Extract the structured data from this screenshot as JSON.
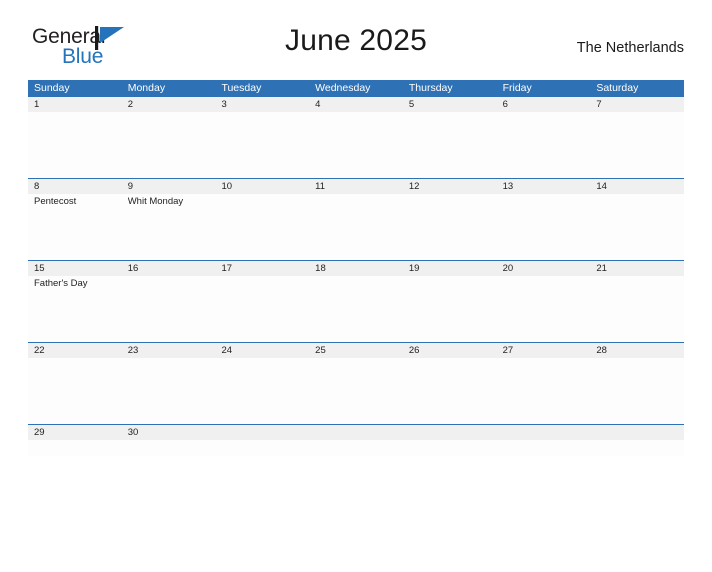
{
  "header": {
    "logo": {
      "text_primary": "General",
      "text_secondary": "Blue",
      "mark": "triangle-flag-icon"
    },
    "title": "June 2025",
    "region": "The Netherlands"
  },
  "calendar": {
    "weekdays": [
      "Sunday",
      "Monday",
      "Tuesday",
      "Wednesday",
      "Thursday",
      "Friday",
      "Saturday"
    ],
    "accent_color": "#2e71b4",
    "band_color": "#f0f0f0",
    "weeks": [
      {
        "days": [
          {
            "num": "1",
            "event": ""
          },
          {
            "num": "2",
            "event": ""
          },
          {
            "num": "3",
            "event": ""
          },
          {
            "num": "4",
            "event": ""
          },
          {
            "num": "5",
            "event": ""
          },
          {
            "num": "6",
            "event": ""
          },
          {
            "num": "7",
            "event": ""
          }
        ]
      },
      {
        "days": [
          {
            "num": "8",
            "event": "Pentecost"
          },
          {
            "num": "9",
            "event": "Whit Monday"
          },
          {
            "num": "10",
            "event": ""
          },
          {
            "num": "11",
            "event": ""
          },
          {
            "num": "12",
            "event": ""
          },
          {
            "num": "13",
            "event": ""
          },
          {
            "num": "14",
            "event": ""
          }
        ]
      },
      {
        "days": [
          {
            "num": "15",
            "event": "Father's Day"
          },
          {
            "num": "16",
            "event": ""
          },
          {
            "num": "17",
            "event": ""
          },
          {
            "num": "18",
            "event": ""
          },
          {
            "num": "19",
            "event": ""
          },
          {
            "num": "20",
            "event": ""
          },
          {
            "num": "21",
            "event": ""
          }
        ]
      },
      {
        "days": [
          {
            "num": "22",
            "event": ""
          },
          {
            "num": "23",
            "event": ""
          },
          {
            "num": "24",
            "event": ""
          },
          {
            "num": "25",
            "event": ""
          },
          {
            "num": "26",
            "event": ""
          },
          {
            "num": "27",
            "event": ""
          },
          {
            "num": "28",
            "event": ""
          }
        ]
      },
      {
        "days": [
          {
            "num": "29",
            "event": ""
          },
          {
            "num": "30",
            "event": ""
          },
          {
            "num": "",
            "event": ""
          },
          {
            "num": "",
            "event": ""
          },
          {
            "num": "",
            "event": ""
          },
          {
            "num": "",
            "event": ""
          },
          {
            "num": "",
            "event": ""
          }
        ]
      }
    ]
  }
}
